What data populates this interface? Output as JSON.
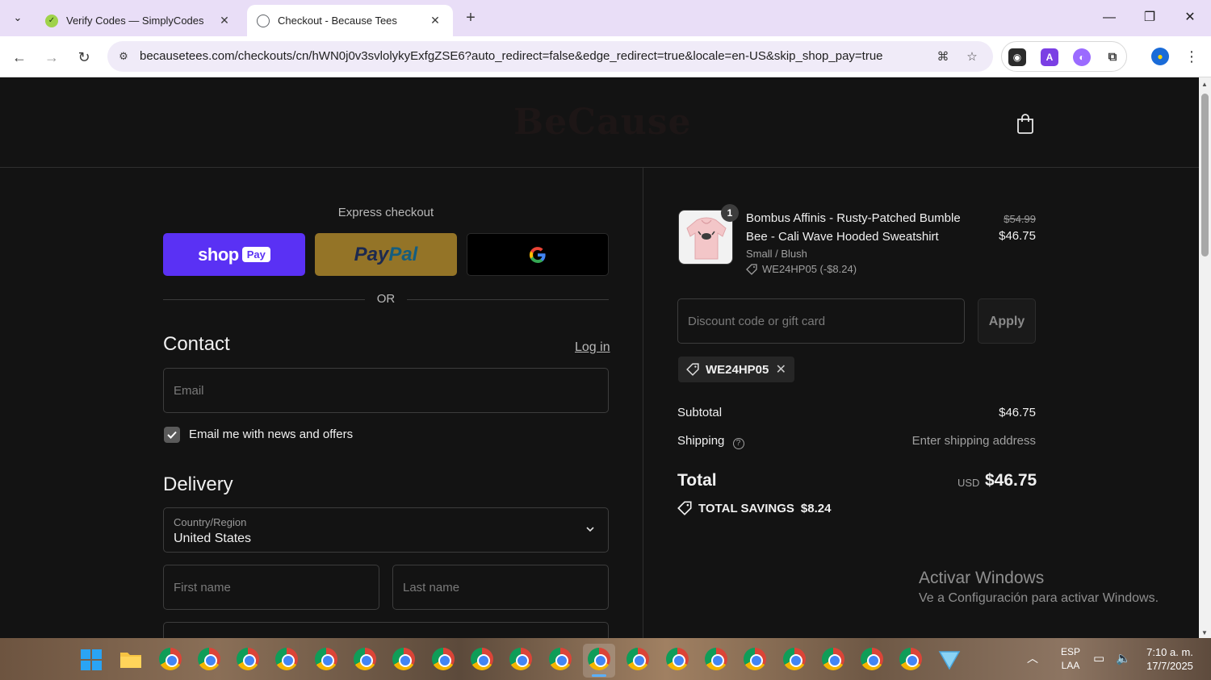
{
  "browser": {
    "tabs": [
      {
        "title": "Verify Codes — SimplyCodes",
        "active": false
      },
      {
        "title": "Checkout - Because Tees",
        "active": true
      }
    ],
    "url": "becausetees.com/checkouts/cn/hWN0j0v3svlolykyExfgZSE6?auto_redirect=false&edge_redirect=true&locale=en-US&skip_shop_pay=true"
  },
  "header": {
    "brand": "BeCause"
  },
  "express": {
    "title": "Express checkout",
    "shop_label": "shop",
    "shop_pay_badge": "Pay",
    "paypal_pay": "Pay",
    "paypal_pal": "Pal",
    "or_text": "OR"
  },
  "contact": {
    "title": "Contact",
    "login_link": "Log in",
    "email_placeholder": "Email",
    "newsletter_label": "Email me with news and offers",
    "newsletter_checked": true
  },
  "delivery": {
    "title": "Delivery",
    "country_label": "Country/Region",
    "country_value": "United States",
    "first_name_placeholder": "First name",
    "last_name_placeholder": "Last name"
  },
  "order": {
    "item": {
      "quantity": "1",
      "name": "Bombus Affinis - Rusty-Patched Bumble Bee - Cali Wave Hooded Sweatshirt",
      "variant": "Small / Blush",
      "discount": "WE24HP05 (-$8.24)",
      "price_original": "$54.99",
      "price_current": "$46.75"
    },
    "discount_placeholder": "Discount code or gift card",
    "apply_label": "Apply",
    "applied_code": "WE24HP05",
    "subtotal_label": "Subtotal",
    "subtotal_value": "$46.75",
    "shipping_label": "Shipping",
    "shipping_value": "Enter shipping address",
    "total_label": "Total",
    "total_currency": "USD",
    "total_value": "$46.75",
    "savings_label": "TOTAL SAVINGS",
    "savings_value": "$8.24"
  },
  "watermark": {
    "line1": "Activar Windows",
    "line2": "Ve a Configuración para activar Windows."
  },
  "taskbar": {
    "tray_lang_1": "ESP",
    "tray_lang_2": "LAA",
    "time": "7:10 a. m.",
    "date": "17/7/2025"
  }
}
